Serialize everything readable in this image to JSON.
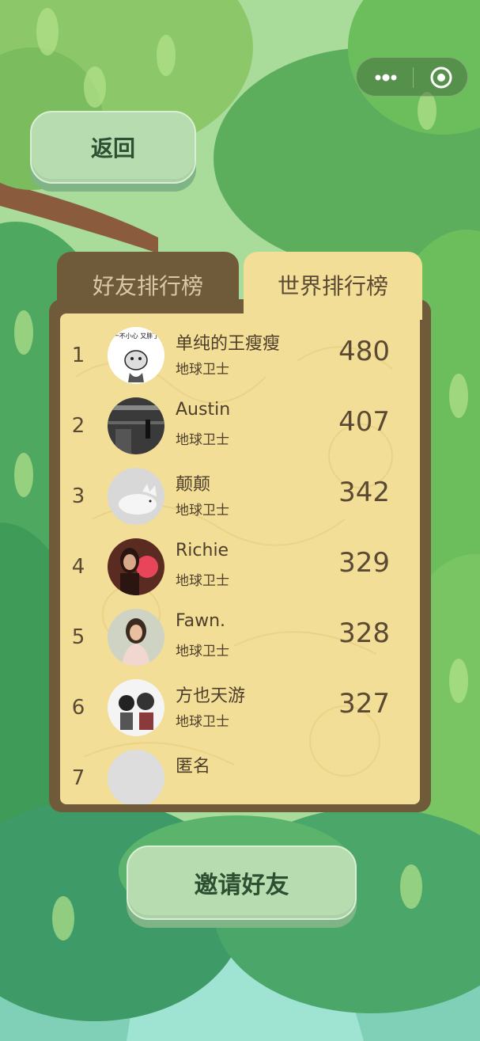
{
  "capsule": {
    "more_icon": "more-dots-icon",
    "close_icon": "target-close-icon"
  },
  "back_label": "返回",
  "tabs": [
    {
      "label": "好友排行榜",
      "active": false
    },
    {
      "label": "世界排行榜",
      "active": true
    }
  ],
  "leaderboard": [
    {
      "rank": "1",
      "name": "单纯的王瘦瘦",
      "title": "地球卫士",
      "score": "480",
      "avatar_text": "一不小心 又胖了"
    },
    {
      "rank": "2",
      "name": "Austin",
      "title": "地球卫士",
      "score": "407"
    },
    {
      "rank": "3",
      "name": "颠颠",
      "title": "地球卫士",
      "score": "342"
    },
    {
      "rank": "4",
      "name": "Richie",
      "title": "地球卫士",
      "score": "329"
    },
    {
      "rank": "5",
      "name": "Fawn.",
      "title": "地球卫士",
      "score": "328"
    },
    {
      "rank": "6",
      "name": "方也天游",
      "title": "地球卫士",
      "score": "327"
    },
    {
      "rank": "7",
      "name": "匿名",
      "title": "",
      "score": ""
    }
  ],
  "invite_label": "邀请好友",
  "colors": {
    "board": "#6f5a3a",
    "paper": "#f3de97",
    "button": "#b6dcb0"
  }
}
